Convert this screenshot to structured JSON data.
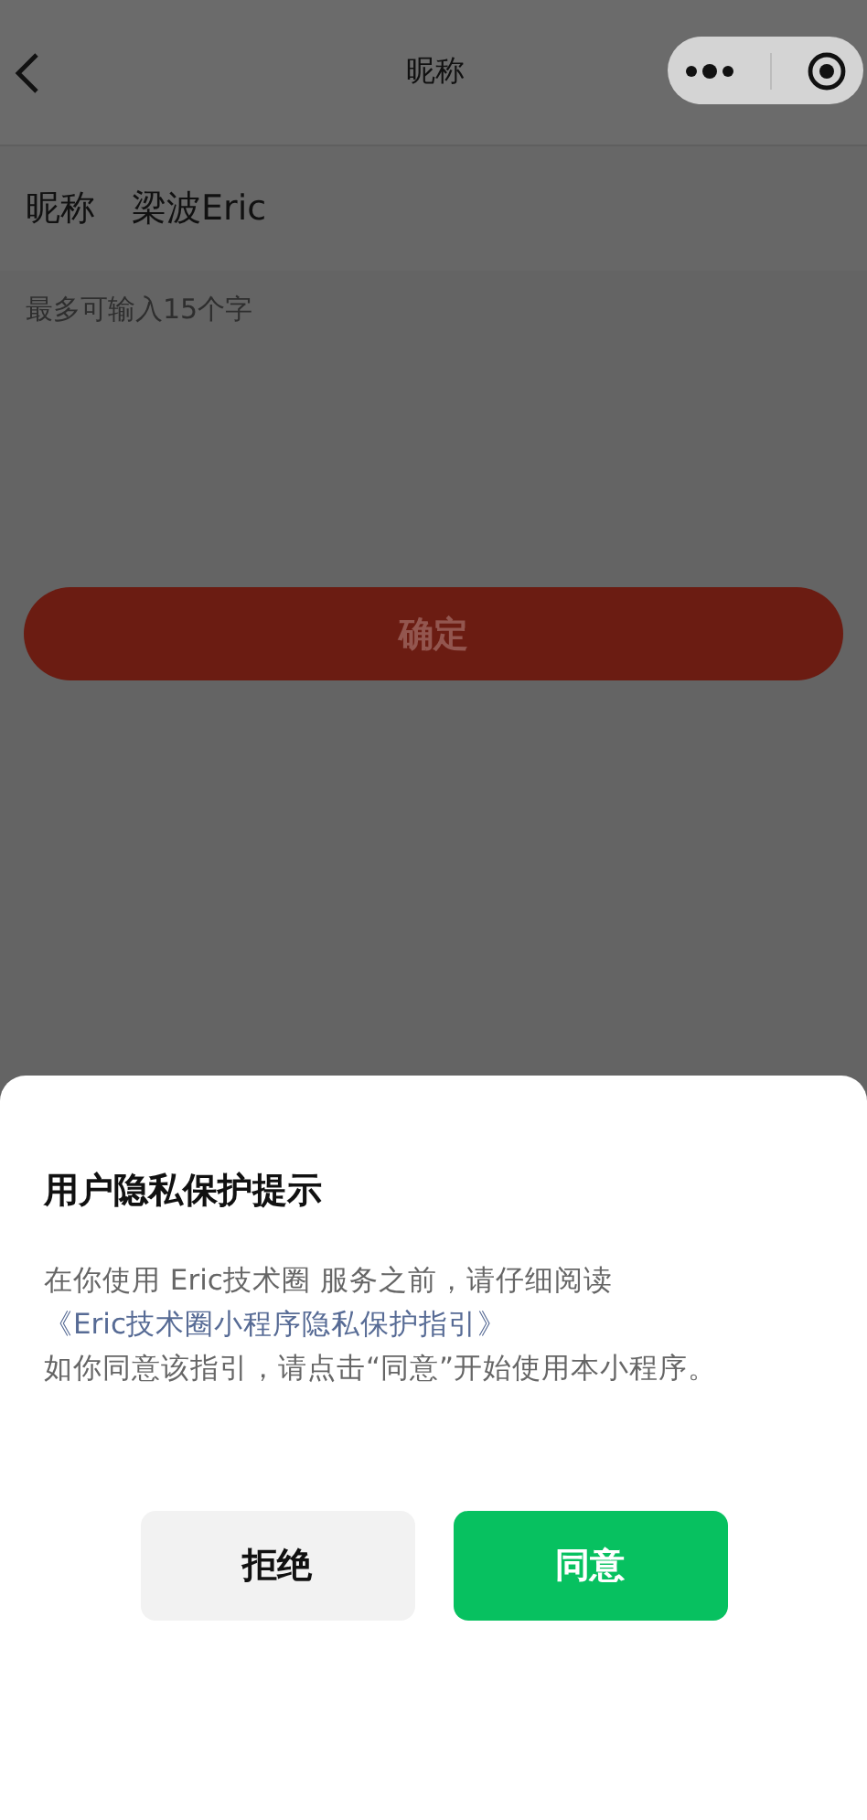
{
  "nav_bar": {
    "title": "昵称"
  },
  "nickname_field": {
    "label": "昵称",
    "value": "梁波Eric",
    "hint": "最多可输入15个字"
  },
  "confirm_button": {
    "label": "确定",
    "disabled": true
  },
  "privacy_dialog": {
    "title": "用户隐私保护提示",
    "text_before": "在你使用 Eric技术圈 服务之前，请仔细阅读",
    "link": "《Eric技术圈小程序隐私保护指引》",
    "text_after": "如你同意该指引，请点击“同意”开始使用本小程序。",
    "buttons": [
      {
        "label": "拒绝",
        "kind": "secondary"
      },
      {
        "label": "同意",
        "kind": "primary"
      }
    ]
  }
}
